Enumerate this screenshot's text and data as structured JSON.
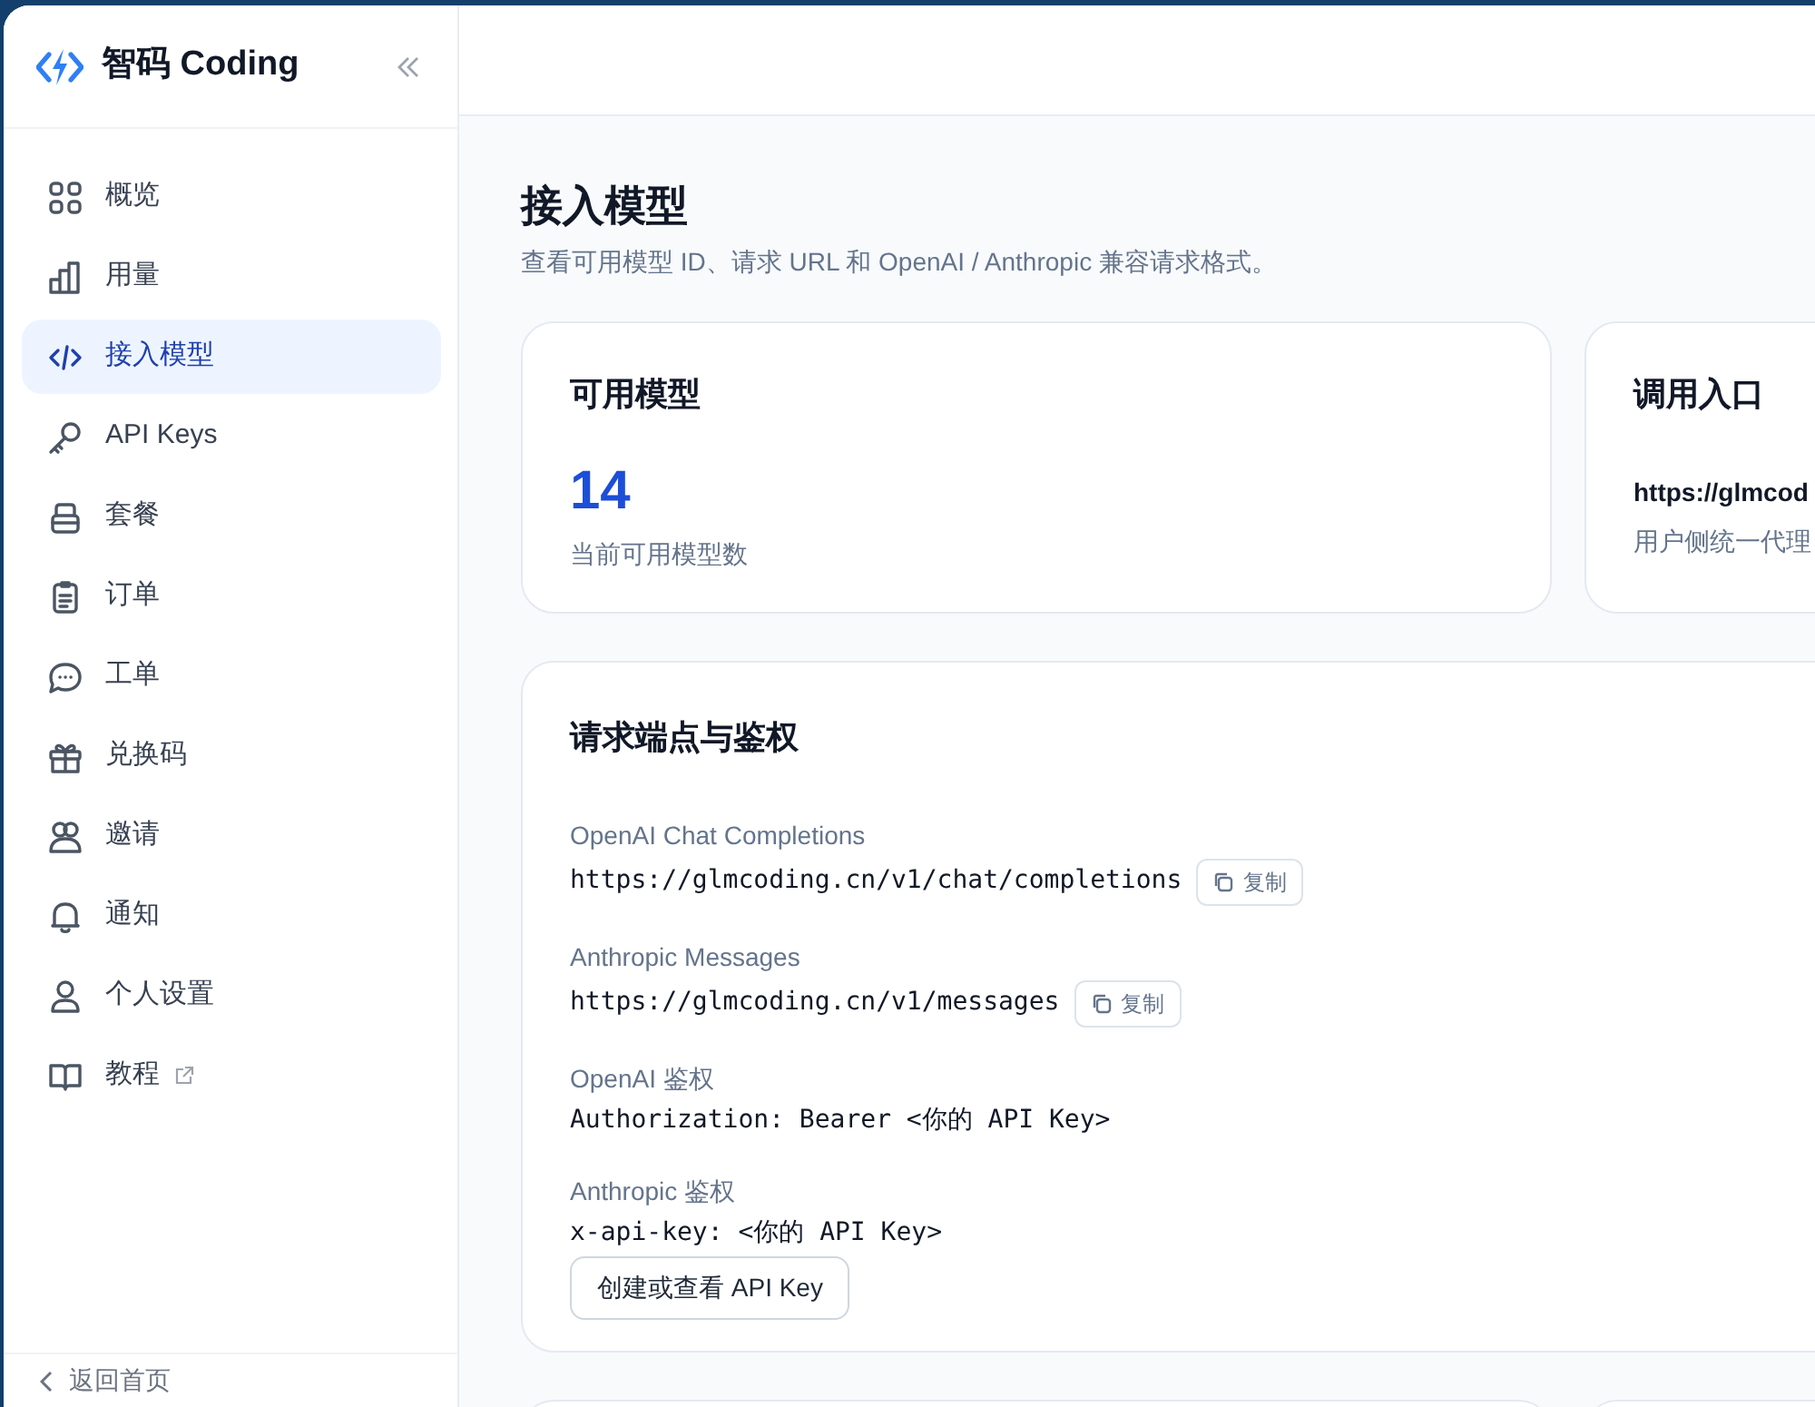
{
  "sidebar": {
    "brand": "智码 Coding",
    "items": [
      {
        "label": "概览",
        "selected": false,
        "external": false
      },
      {
        "label": "用量",
        "selected": false,
        "external": false
      },
      {
        "label": "接入模型",
        "selected": true,
        "external": false
      },
      {
        "label": "API Keys",
        "selected": false,
        "external": false
      },
      {
        "label": "套餐",
        "selected": false,
        "external": false
      },
      {
        "label": "订单",
        "selected": false,
        "external": false
      },
      {
        "label": "工单",
        "selected": false,
        "external": false
      },
      {
        "label": "兑换码",
        "selected": false,
        "external": false
      },
      {
        "label": "邀请",
        "selected": false,
        "external": false
      },
      {
        "label": "通知",
        "selected": false,
        "external": false
      },
      {
        "label": "个人设置",
        "selected": false,
        "external": false
      },
      {
        "label": "教程",
        "selected": false,
        "external": true
      }
    ],
    "footer": "返回首页"
  },
  "page": {
    "title": "接入模型",
    "subtitle": "查看可用模型 ID、请求 URL 和 OpenAI / Anthropic 兼容请求格式。"
  },
  "stat_cards": [
    {
      "kind": "number",
      "title": "可用模型",
      "value": "14",
      "caption": "当前可用模型数"
    },
    {
      "kind": "url",
      "title": "调用入口",
      "value": "https://glmcod",
      "caption": "用户侧统一代理"
    }
  ],
  "endpoints": {
    "title": "请求端点与鉴权",
    "items": [
      {
        "label": "OpenAI Chat Completions",
        "value": "https://glmcoding.cn/v1/chat/completions",
        "copy": "复制"
      },
      {
        "label": "Anthropic Messages",
        "value": "https://glmcoding.cn/v1/messages",
        "copy": "复制"
      },
      {
        "label": "OpenAI 鉴权",
        "value": "Authorization: Bearer <你的 API Key>"
      },
      {
        "label": "Anthropic 鉴权",
        "value": "x-api-key: <你的 API Key>"
      }
    ],
    "button": "创建或查看 API Key"
  }
}
